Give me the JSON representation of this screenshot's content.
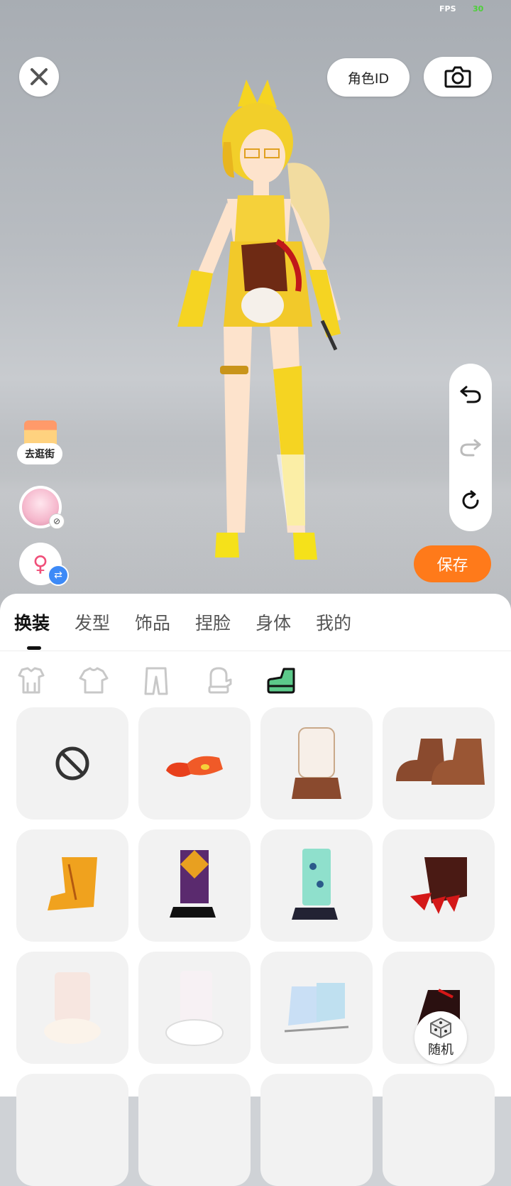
{
  "fps": {
    "label": "FPS",
    "value": "30"
  },
  "top_bar": {
    "close_icon": "close-icon",
    "role_id_label": "角色ID",
    "camera_icon": "camera-icon"
  },
  "history": {
    "undo_icon": "undo-icon",
    "redo_icon": "redo-icon",
    "reset_icon": "reset-icon"
  },
  "save_label": "保存",
  "left_tools": {
    "shop_label": "去逛街",
    "avatar_icon": "avatar-icon",
    "gender_icon": "female-icon"
  },
  "tabs": [
    {
      "label": "换装",
      "active": true
    },
    {
      "label": "发型",
      "active": false
    },
    {
      "label": "饰品",
      "active": false
    },
    {
      "label": "捏脸",
      "active": false
    },
    {
      "label": "身体",
      "active": false
    },
    {
      "label": "我的",
      "active": false
    }
  ],
  "subcategories": [
    {
      "icon": "outfit-icon",
      "active": false
    },
    {
      "icon": "top-icon",
      "active": false
    },
    {
      "icon": "pants-icon",
      "active": false
    },
    {
      "icon": "gloves-icon",
      "active": false
    },
    {
      "icon": "shoes-icon",
      "active": true
    }
  ],
  "items": [
    {
      "icon": "none-icon"
    },
    {
      "icon": "red-flat-shoes"
    },
    {
      "icon": "fluffy-brown-boots"
    },
    {
      "icon": "brown-paw-boots"
    },
    {
      "icon": "yellow-boots"
    },
    {
      "icon": "argyle-socks-shoes"
    },
    {
      "icon": "mint-socks-shoes"
    },
    {
      "icon": "red-claw-boots"
    },
    {
      "icon": "pink-bunny-slippers"
    },
    {
      "icon": "white-bunny-slippers"
    },
    {
      "icon": "holo-ice-skates"
    },
    {
      "icon": "black-red-boots"
    }
  ],
  "random_label": "随机",
  "colors": {
    "accent": "#ff7a1a",
    "active_subcat": "#5cc98a",
    "badge_blue": "#3d8af7",
    "gender_pink": "#f0507a"
  }
}
